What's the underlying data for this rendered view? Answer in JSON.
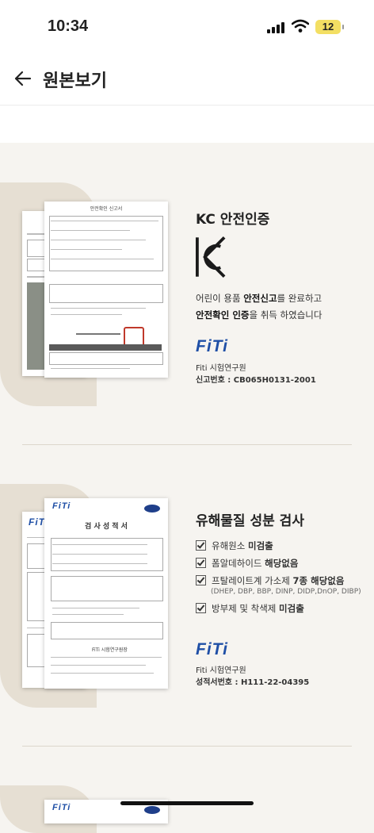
{
  "status": {
    "time": "10:34",
    "battery": "12"
  },
  "appbar": {
    "title": "원본보기"
  },
  "kc": {
    "title": "KC 안전인증",
    "line1_a": "어린이 용품 ",
    "line1_b": "안전신고",
    "line1_c": "를 완료하고",
    "line2_a": "안전확인 인증",
    "line2_b": "을 취득 하였습니다",
    "logo": "FiTi",
    "org": "Fiti 시험연구원",
    "reg": "신고번호 :  CB065H0131-2001",
    "doc_title": "안전확인 신고서"
  },
  "harmful": {
    "title": "유해물질 성분 검사",
    "items": [
      {
        "a": "유해원소 ",
        "b": "미검출"
      },
      {
        "a": "폼알데하이드 ",
        "b": "해당없음"
      },
      {
        "a": "프탈레이트계 가소제 ",
        "b": "7종 해당없음"
      },
      {
        "a": "방부제 및 착색제 ",
        "b": "미검출"
      }
    ],
    "sub": "(DHEP, DBP, BBP, DINP, DIDP,DnOP, DIBP)",
    "logo": "FiTi",
    "org": "Fiti 시험연구원",
    "reg": "성적서번호 :  H111-22-04395",
    "doc_title": "검 사 성 적 서",
    "doc_org": "FiTi 시험연구원장"
  },
  "third": {
    "logo": "FiTi"
  },
  "icons": {
    "back": "arrow-left-icon",
    "signal": "signal-icon",
    "wifi": "wifi-icon",
    "battery": "battery-icon",
    "check": "checkbox-icon"
  }
}
